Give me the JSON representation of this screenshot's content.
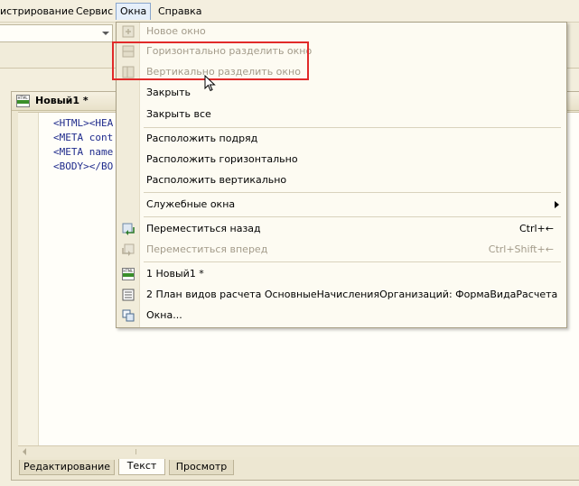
{
  "menubar": {
    "items": [
      "истрирование",
      "Сервис",
      "Окна",
      "Справка"
    ],
    "active": "Окна"
  },
  "document": {
    "title": "Новый1 *",
    "code_lines": [
      "<HTML><HEA",
      "<META cont",
      "<META name",
      "<BODY></BO"
    ],
    "tabs": [
      "Редактирование",
      "Текст",
      "Просмотр"
    ],
    "active_tab": "Текст"
  },
  "menu": {
    "items": [
      {
        "label": "Новое окно",
        "disabled": true,
        "icon": "new-window-icon"
      },
      {
        "label": "Горизонтально разделить окно",
        "disabled": true,
        "icon": "split-horizontal-icon"
      },
      {
        "label": "Вертикально разделить окно",
        "disabled": true,
        "icon": "split-vertical-icon"
      },
      {
        "label": "Закрыть",
        "disabled": false
      },
      {
        "label": "Закрыть все",
        "disabled": false
      },
      {
        "label": "Расположить подряд",
        "disabled": false
      },
      {
        "label": "Расположить горизонтально",
        "disabled": false
      },
      {
        "label": "Расположить вертикально",
        "disabled": false
      },
      {
        "label": "Служебные окна",
        "disabled": false,
        "submenu": true
      },
      {
        "label": "Переместиться назад",
        "disabled": false,
        "shortcut": "Ctrl+←",
        "icon": "move-back-icon"
      },
      {
        "label": "Переместиться вперед",
        "disabled": true,
        "shortcut": "Ctrl+Shift+←",
        "icon": "move-forward-icon"
      },
      {
        "label": "1 Новый1 *",
        "disabled": false,
        "icon": "html-document-icon"
      },
      {
        "label": "2 План видов расчета ОсновныеНачисленияОрганизаций: ФормаВидаРасчета",
        "disabled": false,
        "icon": "form-icon"
      },
      {
        "label": "Окна...",
        "disabled": false,
        "icon": "windows-icon"
      }
    ]
  },
  "colors": {
    "highlight_border": "#e12a2a",
    "code_text": "#1f2b8c",
    "disabled_text": "#a39b8a"
  }
}
